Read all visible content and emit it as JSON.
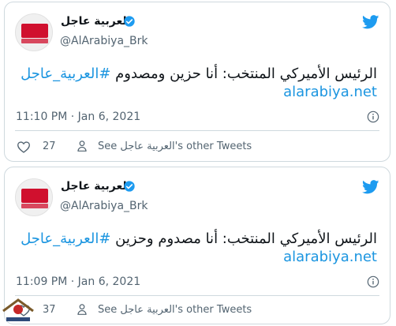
{
  "tweets": [
    {
      "display_name": "العربية عاجل",
      "handle": "@AlArabiya_Brk",
      "text_before": "الرئيس الأميركي المنتخب: أنا حزين ومصدوم ",
      "hashtag": "#العربية_عاجل",
      "link": "alarabiya.net",
      "time": "11:10 PM · Jan 6, 2021",
      "likes": "27",
      "other_tweets": "See العربية عاجل's other Tweets"
    },
    {
      "display_name": "العربية عاجل",
      "handle": "@AlArabiya_Brk",
      "text_before": "الرئيس الأميركي المنتخب: أنا مصدوم وحزين ",
      "hashtag": "#العربية_عاجل",
      "link": "alarabiya.net",
      "time": "11:09 PM · Jan 6, 2021",
      "likes": "37",
      "other_tweets": "See العربية عاجل's other Tweets"
    }
  ],
  "avatar_logo_text": "العربية alarabiya",
  "icons": [
    "verified-badge-icon",
    "twitter-bird-icon",
    "info-icon",
    "heart-icon",
    "person-icon"
  ],
  "colors": {
    "accent": "#1d9bf0",
    "link": "#1b95e0",
    "muted": "#536471",
    "logo": "#d0102e"
  }
}
